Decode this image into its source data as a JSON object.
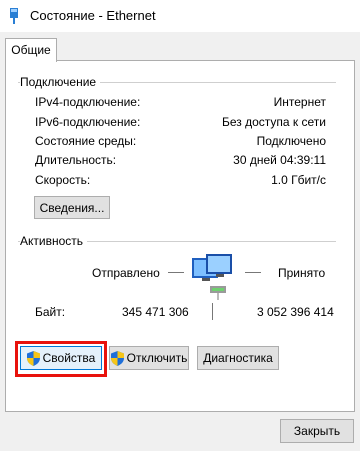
{
  "window": {
    "title": "Состояние - Ethernet",
    "icon": "ethernet-adapter-icon"
  },
  "tabs": [
    {
      "label": "Общие",
      "active": true
    }
  ],
  "connection": {
    "group_label": "Подключение",
    "rows": [
      {
        "label": "IPv4-подключение:",
        "value": "Интернет"
      },
      {
        "label": "IPv6-подключение:",
        "value": "Без доступа к сети"
      },
      {
        "label": "Состояние среды:",
        "value": "Подключено"
      },
      {
        "label": "Длительность:",
        "value": "30 дней 04:39:11"
      },
      {
        "label": "Скорость:",
        "value": "1.0 Гбит/с"
      }
    ],
    "details_button": "Сведения..."
  },
  "activity": {
    "group_label": "Активность",
    "sent_label": "Отправлено",
    "received_label": "Принято",
    "bytes_label": "Байт:",
    "bytes_sent": "345 471 306",
    "bytes_received": "3 052 396 414",
    "icon": "network-computers-icon"
  },
  "actions": {
    "properties": "Свойства",
    "disable": "Отключить",
    "diagnose": "Диагностика"
  },
  "footer": {
    "close": "Закрыть"
  },
  "colors": {
    "highlight": "#e8120c",
    "focus": "#0078d7",
    "accent_blue": "#1e6fd9"
  }
}
